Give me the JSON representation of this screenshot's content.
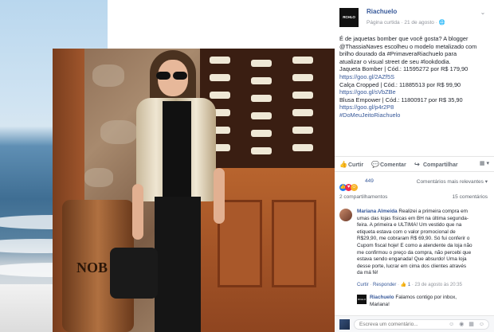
{
  "header": {
    "page_name": "Riachuelo",
    "logo_text": "RCHLO",
    "meta_text": "Página curtida · 21 de agosto · 🌐"
  },
  "post": {
    "lines": [
      {
        "text": "É de jaquetas bomber que você gosta? A blogger",
        "kind": "plain"
      },
      {
        "text": "@ThassiaNaves escolheu o modelo metalizado com",
        "kind": "plain"
      },
      {
        "text": "brilho dourado da #PrimaveraRiachuelo para",
        "kind": "plain"
      },
      {
        "text": "atualizar o visual street de seu #lookdodia.",
        "kind": "plain"
      },
      {
        "text": "Jaqueta Bomber | Cód.: 11595272 por R$ 179,90",
        "kind": "plain"
      },
      {
        "text": "https://goo.gl/2AZf5S",
        "kind": "link"
      },
      {
        "text": "Calça Cropped | Cód.: 11885513 por R$ 99,90",
        "kind": "plain"
      },
      {
        "text": "https://goo.gl/sVbZBe",
        "kind": "link"
      },
      {
        "text": "Blusa Empower | Cód.: 11800917 por R$ 35,90",
        "kind": "plain"
      },
      {
        "text": "https://goo.gl/p4r2P8",
        "kind": "link"
      },
      {
        "text": "#DoMeuJeitoRiachuelo",
        "kind": "link"
      }
    ]
  },
  "actions": {
    "like_label": "Curtir",
    "comment_label": "Comentar",
    "share_label": "Compartilhar",
    "share_menu": "▾"
  },
  "reactions": {
    "count": "449",
    "relevance_label": "Comentários mais relevantes ▾"
  },
  "counts": {
    "shares": "2 compartilhamentos",
    "comments": "15 comentários"
  },
  "comment": {
    "author": "Mariana Almeida",
    "lines": [
      "Realizei a primeira compra em",
      "umas das lojas físicas em BH na última segunda-",
      "feira. A primeira e ÚLTIMA! Um vestido que na",
      "etiqueta estava com o valor promocional de",
      "R$29,90, me cobraram R$ 69,90. Só fui conferir o",
      "Cupom fiscal hoje! E como a atendente da loja não",
      "me confirmou o preço da compra, não percebi que",
      "estava sendo enganada! Que absurdo! Uma loja",
      "desse porte, lucrar em cima dos clientes através",
      "da má fé!"
    ],
    "like_action": "Curtir",
    "reply_action": "Responder",
    "like_count": "👍 1",
    "timestamp": "23 de agosto às 20:35"
  },
  "reply": {
    "author": "Riachuelo",
    "first_line": "Falamos contigo por inbox,",
    "second_line": "Mariana!"
  },
  "composer": {
    "placeholder": "Escreva um comentário...",
    "icons": "☺ ◉ ▦ ☺"
  },
  "photo": {
    "barrel_text": "NOB"
  }
}
